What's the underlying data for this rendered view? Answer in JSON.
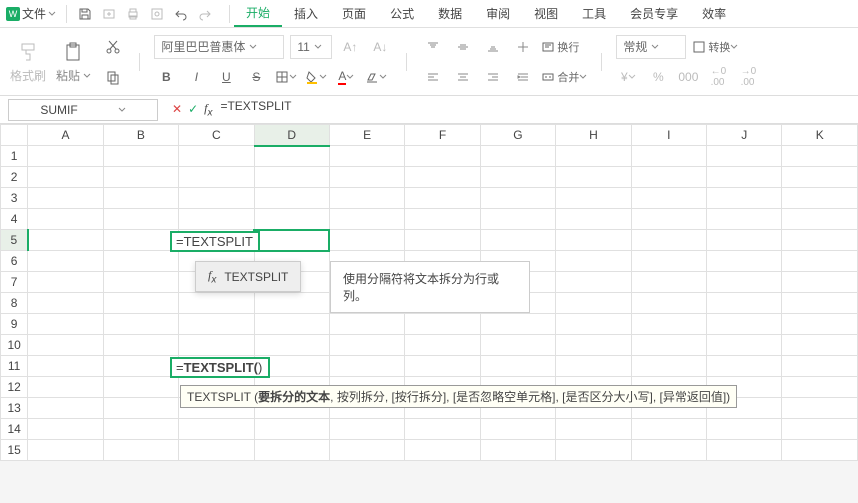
{
  "menu": {
    "file": "文件",
    "start": "开始",
    "insert": "插入",
    "page": "页面",
    "formula": "公式",
    "data": "数据",
    "review": "审阅",
    "view": "视图",
    "tools": "工具",
    "vip": "会员专享",
    "eff": "效率"
  },
  "ribbon": {
    "format_painter": "格式刷",
    "paste": "粘贴",
    "font_name": "阿里巴巴普惠体",
    "font_size": "11",
    "wrap": "换行",
    "merge": "合并",
    "number_format": "常规",
    "convert": "转换"
  },
  "formula_bar": {
    "name_box": "SUMIF",
    "formula": "=TEXTSPLIT"
  },
  "columns": [
    "A",
    "B",
    "C",
    "D",
    "E",
    "F",
    "G",
    "H",
    "I",
    "J",
    "K"
  ],
  "rows": [
    "1",
    "2",
    "3",
    "4",
    "5",
    "6",
    "7",
    "8",
    "9",
    "10",
    "11",
    "12",
    "13",
    "14",
    "15"
  ],
  "cells": {
    "c5": "=TEXTSPLIT",
    "c11_prefix": "=",
    "c11_bold": "TEXTSPLIT(",
    "c11_suffix": ")"
  },
  "autocomplete": {
    "item": "TEXTSPLIT"
  },
  "tooltip": "使用分隔符将文本拆分为行或列。",
  "formula_hint": {
    "prefix": "TEXTSPLIT (",
    "bold": "要拆分的文本",
    "rest": ", 按列拆分, [按行拆分], [是否忽略空单元格], [是否区分大小写], [异常返回值])"
  },
  "chart_data": null
}
